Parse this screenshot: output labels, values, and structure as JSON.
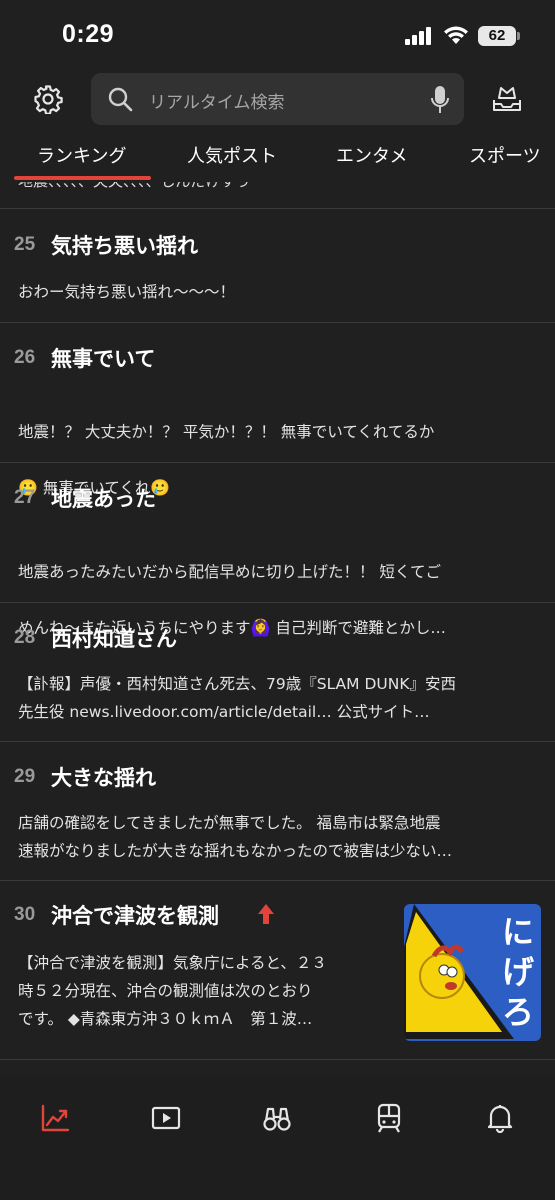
{
  "status": {
    "time": "0:29",
    "battery": "62"
  },
  "search": {
    "placeholder": "リアルタイム検索"
  },
  "tabs": [
    {
      "label": "ランキング",
      "active": true
    },
    {
      "label": "人気ポスト"
    },
    {
      "label": "エンタメ"
    },
    {
      "label": "スポーツ"
    }
  ],
  "partial_previous": "地震、、、、、夫夫、、、、しんだけすう",
  "items": [
    {
      "rank": "25",
      "title": "気持ち悪い揺れ",
      "desc": "おわー気持ち悪い揺れ〜〜〜！"
    },
    {
      "rank": "26",
      "title": "無事でいて",
      "desc_line1": "地震！？ 大丈夫か！？ 平気か！？！ 無事でいてくれてるか",
      "desc_line2_emoji": "🥲",
      "desc_line2": " 無事でいてくれ",
      "desc_line2_emoji_end": "🥲"
    },
    {
      "rank": "27",
      "title": "地震あった",
      "desc_line1": "地震あったみたいだから配信早めに切り上げた！！ 短くてご",
      "desc_line2": "めんね〜また近いうちにやります",
      "desc_line2_emoji": "🙆‍♀️",
      "desc_line2_end": " 自己判断で避難とかし…"
    },
    {
      "rank": "28",
      "title": "西村知道さん",
      "desc": "【訃報】声優・西村知道さん死去、79歳『SLAM DUNK』安西\n先生役 news.livedoor.com/article/detail… 公式サイト…"
    },
    {
      "rank": "29",
      "title": "大きな揺れ",
      "desc": "店舗の確認をしてきましたが無事でした。 福島市は緊急地震\n速報がなりましたが大きな揺れもなかったので被害は少ない…"
    },
    {
      "rank": "30",
      "title": "沖合で津波を観測",
      "desc": "【沖合で津波を観測】気象庁によると、２３\n時５２分現在、沖合の観測値は次のとおり\nです。 ◆青森東方沖３０ｋｍＡ　第１波…",
      "thumb_text": "にげろ"
    }
  ],
  "bottom_nav": [
    {
      "icon": "trending-icon",
      "active": true
    },
    {
      "icon": "video-icon"
    },
    {
      "icon": "binoculars-icon"
    },
    {
      "icon": "train-icon"
    },
    {
      "icon": "bell-icon"
    }
  ],
  "colors": {
    "accent": "#e0443a",
    "background": "#202020",
    "search_bg": "#323232"
  }
}
